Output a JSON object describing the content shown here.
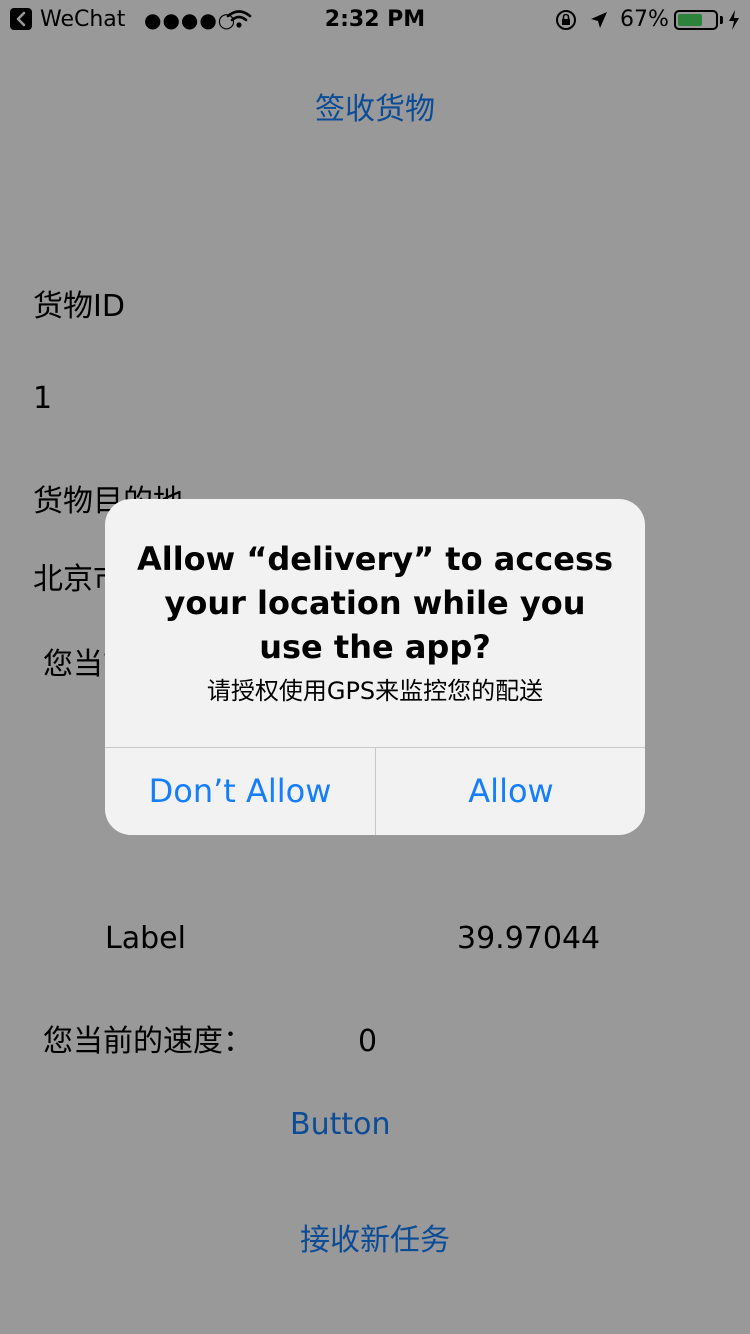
{
  "status_bar": {
    "carrier": "WeChat",
    "signal": "●●●●○",
    "time": "2:32 PM",
    "battery_percent": "67%",
    "battery_level": 0.67
  },
  "page": {
    "title": "签收货物",
    "cargo_id_label": "货物ID",
    "cargo_id_value": "1",
    "destination_label": "货物目的地",
    "destination_value": "北京市",
    "location_label": "您当前的位置：",
    "coordinate_label": "Label",
    "coordinate_value": "39.97044",
    "speed_label": "您当前的速度：",
    "speed_value": "0",
    "button_label": "Button",
    "new_task_label": "接收新任务"
  },
  "alert": {
    "title": "Allow “delivery” to access your location while you use the app?",
    "message": "请授权使用GPS来监控您的配送",
    "dont_allow": "Don’t Allow",
    "allow": "Allow"
  },
  "colors": {
    "accent": "#157efb",
    "overlay": "rgba(0,0,0,0.40)",
    "battery": "#4cd964"
  }
}
